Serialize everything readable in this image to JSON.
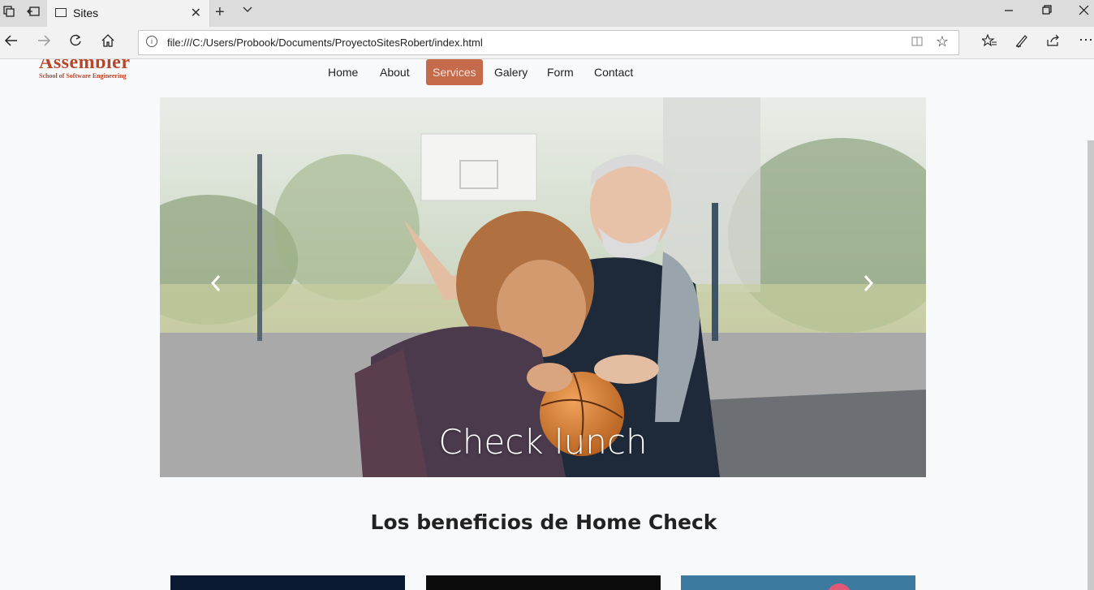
{
  "browser": {
    "tab_title": "Sites",
    "address": "file:///C:/Users/Probook/Documents/ProyectoSitesRobert/index.html"
  },
  "site": {
    "logo_main": "Assembler",
    "logo_sub": "School of Software Engineering",
    "nav": [
      "Home",
      "About",
      "Services",
      "Galery",
      "Form",
      "Contact"
    ],
    "active_nav": "Services"
  },
  "carousel": {
    "caption": "Check lunch",
    "prev_icon": "chevron-left-icon",
    "next_icon": "chevron-right-icon"
  },
  "section": {
    "title": "Los beneficios de Home Check"
  },
  "colors": {
    "brand": "#b9452a",
    "active_nav": "#c56a4b",
    "page_bg": "#f8f9fa"
  }
}
